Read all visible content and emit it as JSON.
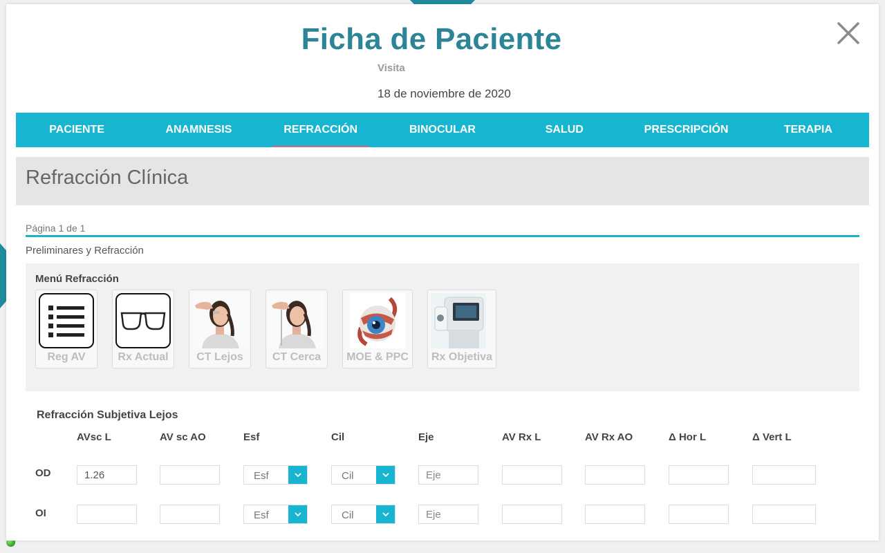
{
  "modal": {
    "title": "Ficha de Paciente",
    "visit_label": "Visita",
    "visit_date": "18 de noviembre de 2020"
  },
  "tabs": [
    {
      "label": "PACIENTE",
      "active": false
    },
    {
      "label": "ANAMNESIS",
      "active": false
    },
    {
      "label": "REFRACCIÓN",
      "active": true
    },
    {
      "label": "BINOCULAR",
      "active": false
    },
    {
      "label": "SALUD",
      "active": false
    },
    {
      "label": "PRESCRIPCIÓN",
      "active": false
    },
    {
      "label": "TERAPIA",
      "active": false
    }
  ],
  "section": {
    "title": "Refracción Clínica",
    "page_info": "Página 1 de 1",
    "group": "Preliminares y Refracción"
  },
  "menu": {
    "title": "Menú Refracción",
    "items": [
      {
        "label": "Reg AV",
        "icon": "list-icon"
      },
      {
        "label": "Rx Actual",
        "icon": "glasses-icon"
      },
      {
        "label": "CT Lejos",
        "icon": "cover-test-photo"
      },
      {
        "label": "CT Cerca",
        "icon": "cover-test-photo"
      },
      {
        "label": "MOE & PPC",
        "icon": "eye-muscle-icon"
      },
      {
        "label": "Rx Objetiva",
        "icon": "autorefractor-photo"
      }
    ]
  },
  "subjective": {
    "title": "Refracción Subjetiva Lejos",
    "columns": [
      "AVsc L",
      "AV sc AO",
      "Esf",
      "Cil",
      "Eje",
      "AV Rx L",
      "AV Rx AO",
      "Δ Hor L",
      "Δ Vert L"
    ],
    "rows": [
      {
        "label": "OD",
        "avsc_l": "1.26",
        "av_sc_ao": "",
        "esf": "Esf",
        "cil": "Cil",
        "eje_placeholder": "Eje",
        "av_rx_l": "",
        "av_rx_ao": "",
        "hor_l": "",
        "vert_l": ""
      },
      {
        "label": "OI",
        "avsc_l": "",
        "av_sc_ao": "",
        "esf": "Esf",
        "cil": "Cil",
        "eje_placeholder": "Eje",
        "av_rx_l": "",
        "av_rx_ao": "",
        "hor_l": "",
        "vert_l": ""
      }
    ]
  },
  "colors": {
    "accent": "#17b5d0",
    "title": "#2b8597",
    "active_tab_underline": "#d06a7c"
  }
}
